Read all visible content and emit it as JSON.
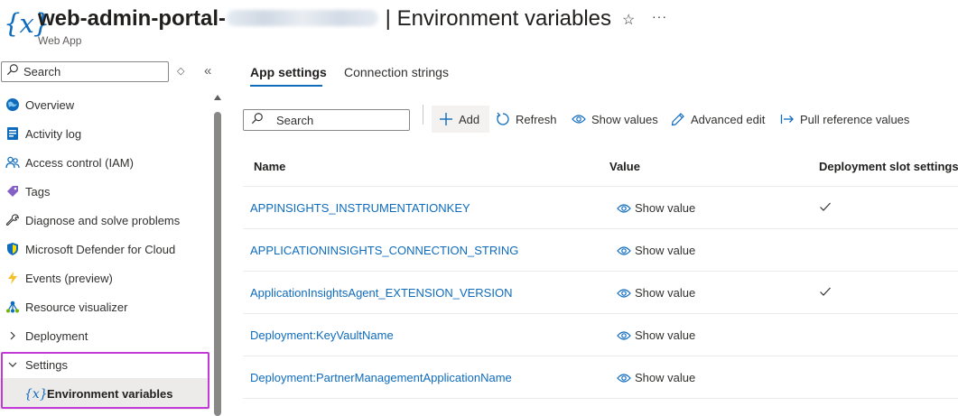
{
  "header": {
    "icon": "{x}",
    "title_name": "web-admin-portal-",
    "title_separator": "|",
    "title_page": "Environment variables",
    "subtitle": "Web App",
    "favorite_icon": "star-outline-icon",
    "more_icon": "ellipsis-icon"
  },
  "sidebar": {
    "search_placeholder": "Search",
    "items": [
      {
        "label": "Overview",
        "icon": "overview-globe-icon"
      },
      {
        "label": "Activity log",
        "icon": "activity-log-icon"
      },
      {
        "label": "Access control (IAM)",
        "icon": "people-icon"
      },
      {
        "label": "Tags",
        "icon": "tag-icon"
      },
      {
        "label": "Diagnose and solve problems",
        "icon": "wrench-icon"
      },
      {
        "label": "Microsoft Defender for Cloud",
        "icon": "shield-icon"
      },
      {
        "label": "Events (preview)",
        "icon": "lightning-icon"
      },
      {
        "label": "Resource visualizer",
        "icon": "visualizer-icon"
      },
      {
        "label": "Deployment",
        "icon": "chevron-right-icon"
      },
      {
        "label": "Settings",
        "icon": "chevron-down-icon"
      }
    ],
    "active_subitem": {
      "icon": "{x}",
      "label": "Environment variables"
    },
    "highlight_color": "#c239d7"
  },
  "tabs": [
    {
      "label": "App settings",
      "active": true
    },
    {
      "label": "Connection strings",
      "active": false
    }
  ],
  "toolbar": {
    "search_placeholder": "Search",
    "add": "Add",
    "refresh": "Refresh",
    "show_values": "Show values",
    "advanced_edit": "Advanced edit",
    "pull_reference": "Pull reference values"
  },
  "table": {
    "headers": {
      "name": "Name",
      "value": "Value",
      "slot": "Deployment slot settings"
    },
    "rows": [
      {
        "name": "APPINSIGHTS_INSTRUMENTATIONKEY",
        "value": "Show value",
        "slot_setting": true
      },
      {
        "name": "APPLICATIONINSIGHTS_CONNECTION_STRING",
        "value": "Show value",
        "slot_setting": false
      },
      {
        "name": "ApplicationInsightsAgent_EXTENSION_VERSION",
        "value": "Show value",
        "slot_setting": true
      },
      {
        "name": "Deployment:KeyVaultName",
        "value": "Show value",
        "slot_setting": false
      },
      {
        "name": "Deployment:PartnerManagementApplicationName",
        "value": "Show value",
        "slot_setting": false
      }
    ]
  },
  "colors": {
    "accent": "#0f6cbd",
    "text": "#323130",
    "selected_bg": "#edebe9"
  }
}
